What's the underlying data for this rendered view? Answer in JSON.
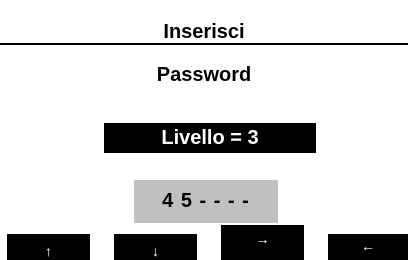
{
  "header": {
    "title": "Inserisci"
  },
  "main": {
    "subtitle": "Password",
    "level_label": "Livello = 3",
    "password_value": "4 5 - - - -"
  },
  "buttons": {
    "up": "↑",
    "down": "↓",
    "right": "→",
    "left": "←"
  },
  "colors": {
    "background": "#ffffff",
    "foreground": "#000000",
    "level_box": "#000000",
    "password_box": "#c0c0c0",
    "button": "#000000"
  }
}
